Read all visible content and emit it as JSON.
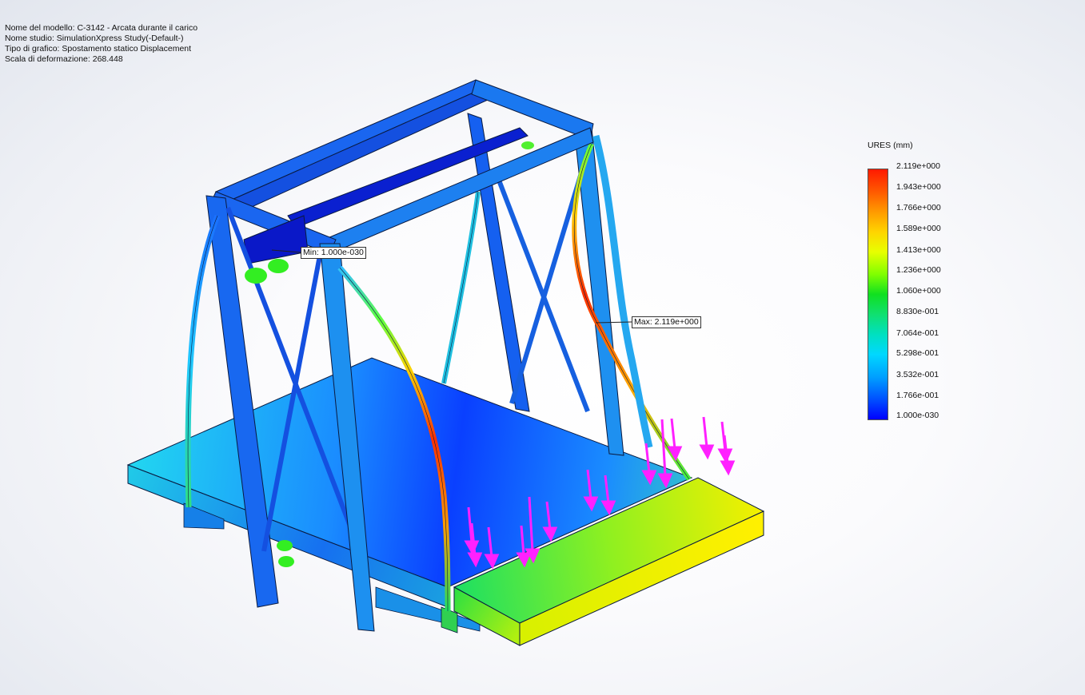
{
  "info": {
    "model_name": "Nome del modello: C-3142 - Arcata durante il carico",
    "study_name": "Nome studio: SimulationXpress Study(-Default-)",
    "plot_type": "Tipo di grafico: Spostamento statico Displacement",
    "deformation_scale": "Scala di deformazione: 268.448"
  },
  "legend": {
    "title": "URES (mm)",
    "ticks": [
      "2.119e+000",
      "1.943e+000",
      "1.766e+000",
      "1.589e+000",
      "1.413e+000",
      "1.236e+000",
      "1.060e+000",
      "8.830e-001",
      "7.064e-001",
      "5.298e-001",
      "3.532e-001",
      "1.766e-001",
      "1.000e-030"
    ],
    "colors": {
      "max": "#ff1a00",
      "mid": "#10e020",
      "min": "#0000ff"
    }
  },
  "callouts": {
    "min_label": "Min: 1.000e-030",
    "max_label": "Max: 2.119e+000"
  },
  "scene": {
    "load_arrow_color": "#ff20ff",
    "fixture_color": "#33ee22"
  }
}
